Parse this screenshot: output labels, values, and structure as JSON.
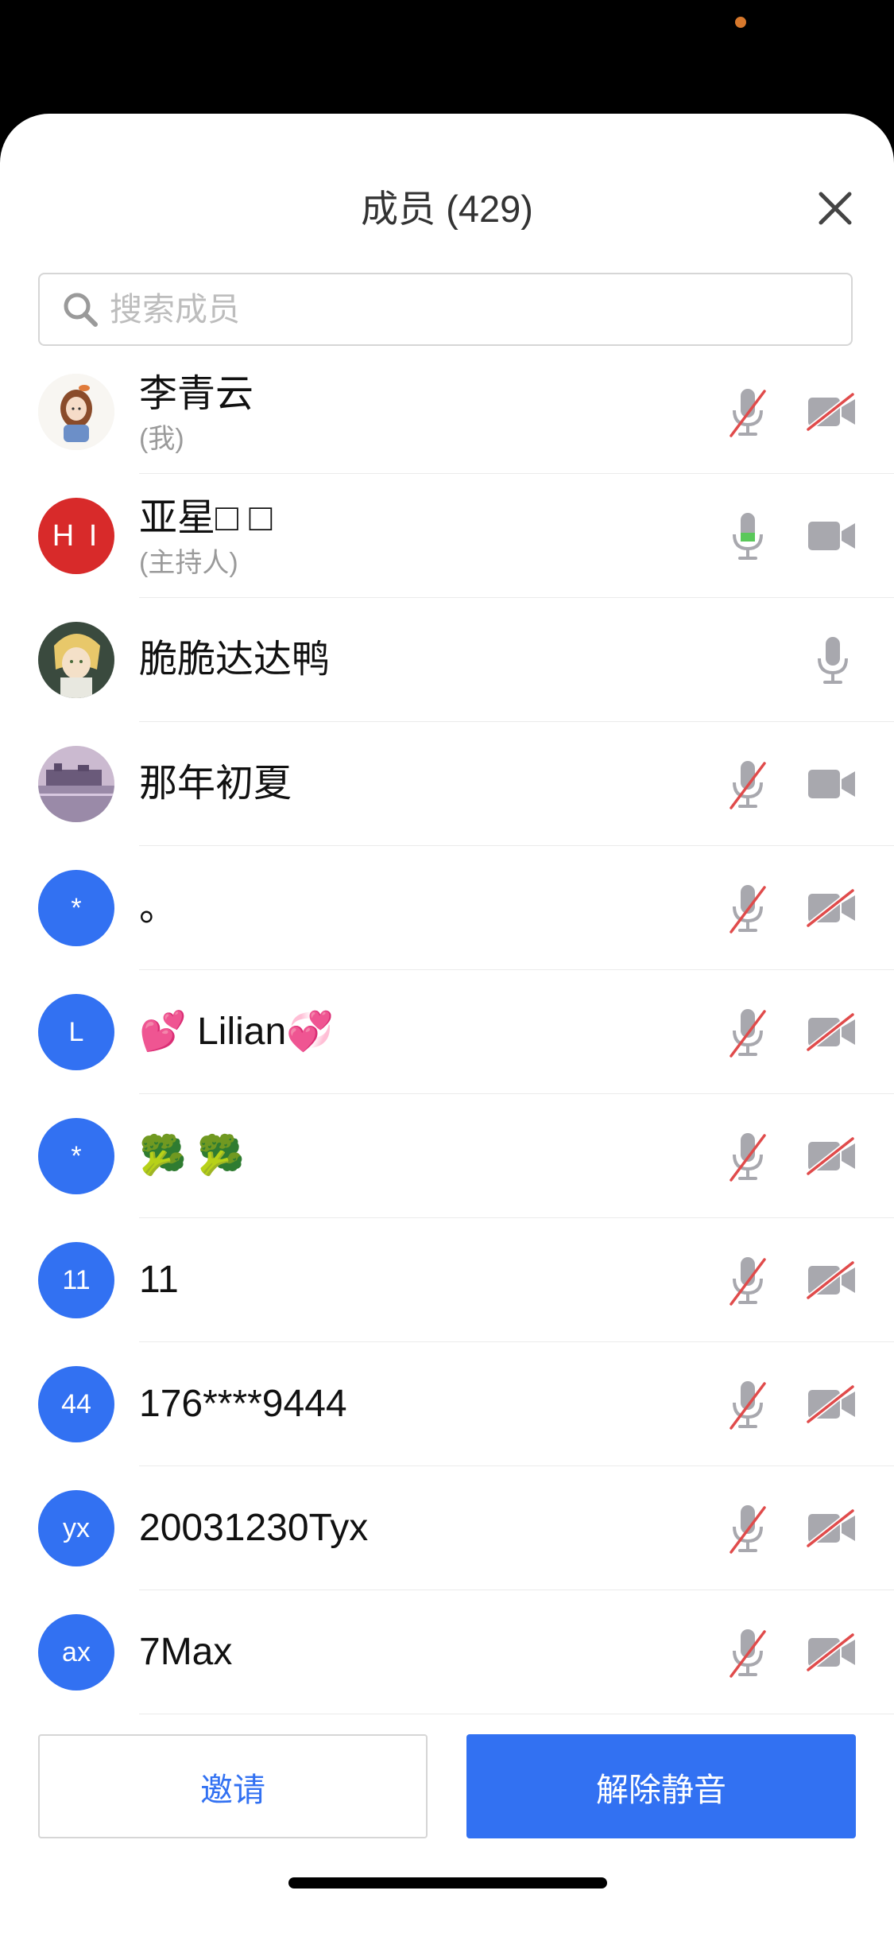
{
  "header": {
    "title": "成员 (429)"
  },
  "search": {
    "placeholder": "搜索成员"
  },
  "members": [
    {
      "name": "李青云",
      "subtitle": "(我)",
      "avatar_type": "photo-girl",
      "mic": "muted",
      "camera": "off"
    },
    {
      "name": "亚星□ □",
      "subtitle": "(主持人)",
      "avatar_type": "initials",
      "avatar_text": "H I",
      "avatar_color": "#d82a2a",
      "mic": "active",
      "camera": "on"
    },
    {
      "name": "脆脆达达鸭",
      "avatar_type": "photo-anime",
      "mic": "on",
      "camera": "none"
    },
    {
      "name": "那年初夏",
      "avatar_type": "photo-landscape",
      "mic": "muted",
      "camera": "on"
    },
    {
      "name": "。",
      "avatar_type": "initials",
      "avatar_text": "*",
      "avatar_color": "#3271f2",
      "mic": "muted",
      "camera": "off"
    },
    {
      "name": "💕 Lilian💞",
      "avatar_type": "initials",
      "avatar_text": "L",
      "avatar_color": "#3271f2",
      "mic": "muted",
      "camera": "off"
    },
    {
      "name": "🥦 🥦",
      "avatar_type": "initials",
      "avatar_text": "*",
      "avatar_color": "#3271f2",
      "mic": "muted",
      "camera": "off"
    },
    {
      "name": "11",
      "avatar_type": "initials",
      "avatar_text": "11",
      "avatar_color": "#3271f2",
      "mic": "muted",
      "camera": "off"
    },
    {
      "name": "176****9444",
      "avatar_type": "initials",
      "avatar_text": "44",
      "avatar_color": "#3271f2",
      "mic": "muted",
      "camera": "off"
    },
    {
      "name": "20031230Tyx",
      "avatar_type": "initials",
      "avatar_text": "yx",
      "avatar_color": "#3271f2",
      "mic": "muted",
      "camera": "off"
    },
    {
      "name": "7Max",
      "avatar_type": "initials",
      "avatar_text": "ax",
      "avatar_color": "#3271f2",
      "mic": "muted",
      "camera": "off"
    }
  ],
  "footer": {
    "invite_label": "邀请",
    "unmute_all_label": "解除静音"
  },
  "colors": {
    "accent": "#3271f2",
    "muted_slash": "#e04b4b",
    "active_mic": "#5ac85a",
    "icon_gray": "#a8a8ae"
  }
}
